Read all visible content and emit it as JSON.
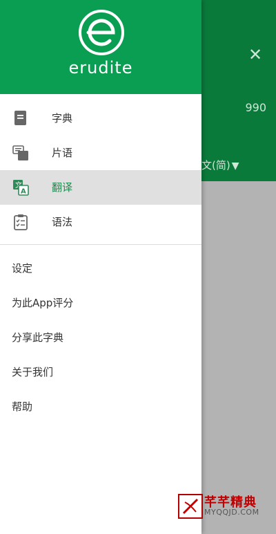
{
  "background": {
    "count": "990",
    "language": "文(简)",
    "language_arrow": "▼",
    "close_glyph": "✕"
  },
  "drawer": {
    "logo_text": "erudite",
    "nav": [
      {
        "label": "字典",
        "icon": "dictionary-icon",
        "active": false
      },
      {
        "label": "片语",
        "icon": "phrases-icon",
        "active": false
      },
      {
        "label": "翻译",
        "icon": "translate-icon",
        "active": true
      },
      {
        "label": "语法",
        "icon": "grammar-clipboard-icon",
        "active": false
      }
    ],
    "secondary": [
      {
        "label": "设定"
      },
      {
        "label": "为此App评分"
      },
      {
        "label": "分享此字典"
      },
      {
        "label": "关于我们"
      },
      {
        "label": "帮助"
      }
    ]
  },
  "watermark": {
    "title": "芊芊精典",
    "subtitle": "MYQQJD.COM"
  },
  "colors": {
    "drawer_header": "#0a9e52",
    "app_header": "#0a7a3b",
    "active_text": "#1f8a4d",
    "active_bg": "#e0e0e0"
  }
}
